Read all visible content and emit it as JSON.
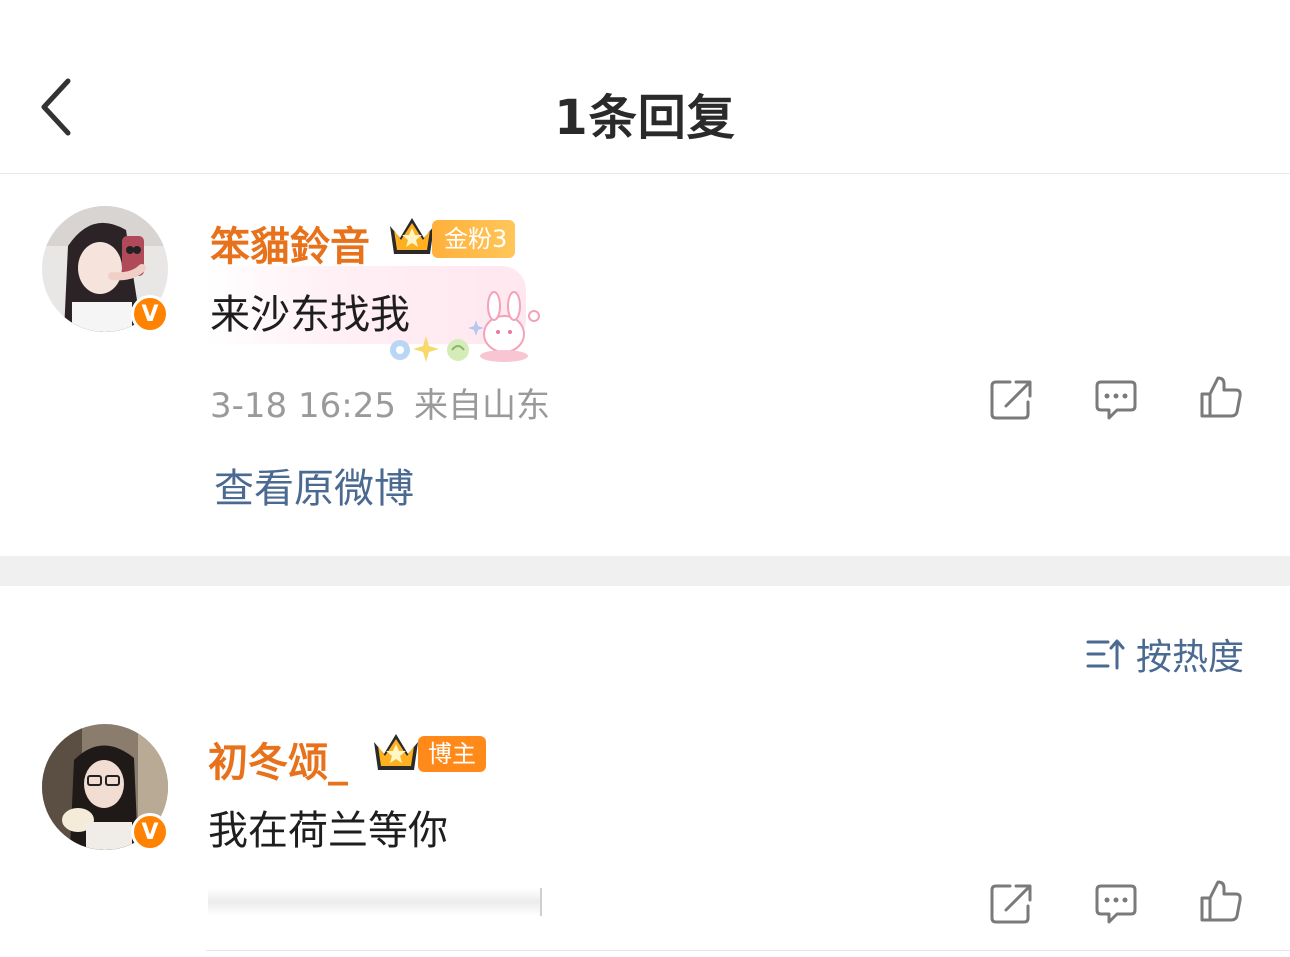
{
  "header": {
    "title": "1条回复"
  },
  "root_comment": {
    "username": "笨貓鈴音",
    "fan_badge": "金粉3",
    "verified_label": "V",
    "text": "来沙东找我",
    "time": "3-18 16:25",
    "location": "来自山东",
    "view_original": "查看原微博"
  },
  "sort": {
    "label": "按热度"
  },
  "reply": {
    "username": "初冬颂_",
    "role_badge": "博主",
    "verified_label": "V",
    "text": "我在荷兰等你"
  },
  "icons": {
    "back": "chevron-left-icon",
    "share": "share-icon",
    "comment": "comment-icon",
    "like": "thumbs-up-icon",
    "sort": "sort-icon",
    "crown": "crown-icon"
  },
  "colors": {
    "username": "#e8721c",
    "link": "#4a6a92",
    "meta": "#9a9a9a",
    "verified": "#ff8200",
    "fan_badge": "#ffb03a",
    "blogger_badge": "#ff8a1a"
  }
}
